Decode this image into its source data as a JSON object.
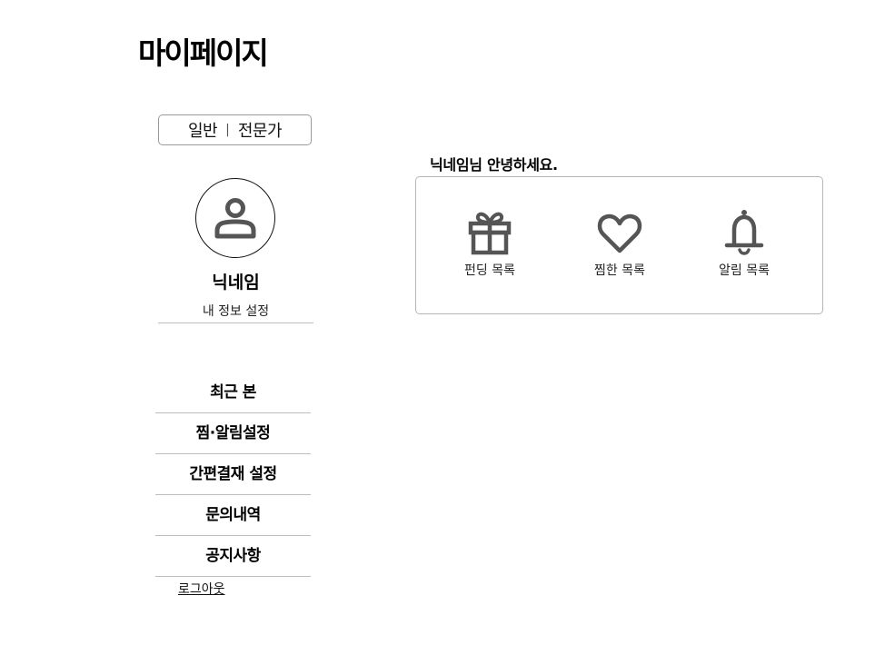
{
  "header": {
    "title": "마이페이지"
  },
  "mode_toggle": {
    "general": "일반",
    "separator": "|",
    "expert": "전문가"
  },
  "profile": {
    "nickname": "닉네임",
    "settings_link": "내 정보 설정"
  },
  "menu": [
    {
      "label": "최근 본"
    },
    {
      "label": "찜·알림설정"
    },
    {
      "label": "간편결재 설정"
    },
    {
      "label": "문의내역"
    },
    {
      "label": "공지사항"
    }
  ],
  "logout": {
    "label": "로그아웃"
  },
  "main": {
    "greeting": "닉네임님 안녕하세요.",
    "shortcuts": [
      {
        "icon": "gift-icon",
        "label": "펀딩 목록"
      },
      {
        "icon": "heart-icon",
        "label": "찜한 목록"
      },
      {
        "icon": "bell-icon",
        "label": "알림 목록"
      }
    ]
  },
  "colors": {
    "icon": "#555555",
    "border": "#b5b5b5",
    "text": "#111111"
  }
}
